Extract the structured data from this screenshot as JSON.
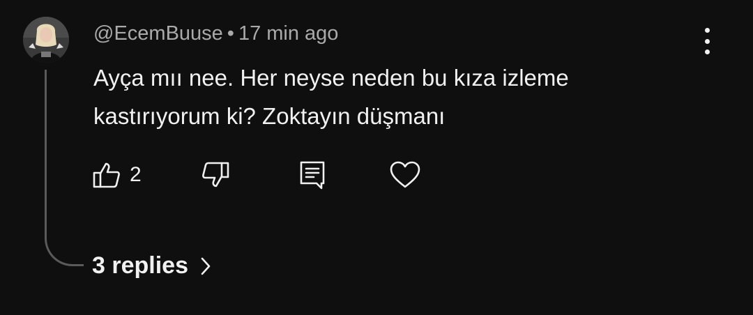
{
  "comment": {
    "author": "@EcemBuuse",
    "separator": "•",
    "time": "17 min ago",
    "text": "Ayça mıı nee. Her neyse neden bu kıza izleme kastırıyorum ki? Zoktayın düşmanı",
    "like_count": "2",
    "replies_label": "3 replies"
  },
  "icons": {
    "like": "thumbs-up-icon",
    "dislike": "thumbs-down-icon",
    "reply": "comment-icon",
    "heart": "heart-icon",
    "more": "more-vert-icon",
    "chevron": "chevron-right-icon"
  },
  "colors": {
    "background": "#0f0f0f",
    "text": "#f1f1f1",
    "meta": "#aaaaaa",
    "thread_line": "#5a5a5a"
  }
}
